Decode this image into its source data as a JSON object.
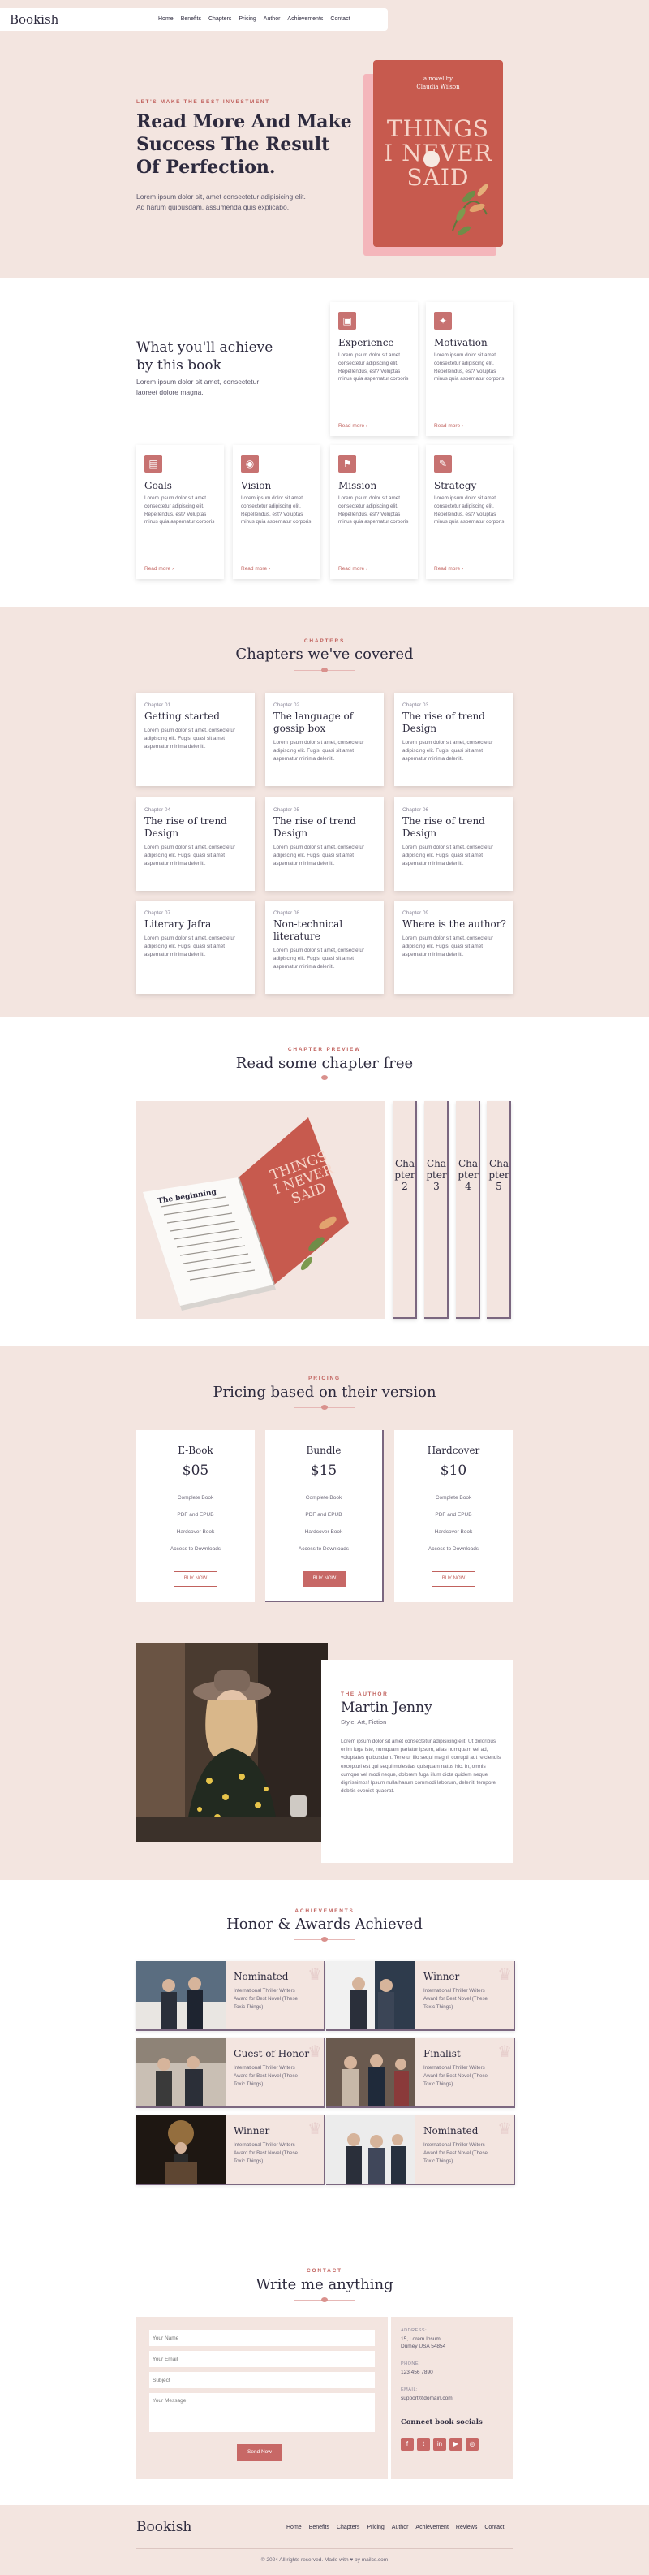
{
  "header": {
    "logo": "Bookish",
    "nav": [
      "Home",
      "Benefits",
      "Chapters",
      "Pricing",
      "Author",
      "Achievements",
      "Contact"
    ]
  },
  "hero": {
    "eyebrow": "Let's make the best investment",
    "title_lines": [
      "Read More And Make",
      "Success The Result",
      "Of Perfection."
    ],
    "text_lines": [
      "Lorem ipsum dolor sit, amet consectetur adipisicing elit.",
      "Ad harum quibusdam, assumenda quis explicabo."
    ],
    "book": {
      "small_lines": [
        "a novel by",
        "Claudia Wilson"
      ],
      "title_lines": [
        "THINGS",
        "I NEVER",
        "SAID"
      ]
    }
  },
  "achieve": {
    "title_lines": [
      "What you'll achieve",
      "by this book"
    ],
    "text_lines": [
      "Lorem ipsum dolor sit amet, consectetur",
      "laoreet dolore magna."
    ],
    "cards": [
      {
        "icon": "experience-icon",
        "glyph": "▣",
        "title": "Experience",
        "text": "Lorem ipsum dolor sit amet consectetur adipiscing elit. Repellendus, est? Voluptas minus quia aspernatur corporis",
        "link": "Read more ›"
      },
      {
        "icon": "motivation-icon",
        "glyph": "✦",
        "title": "Motivation",
        "text": "Lorem ipsum dolor sit amet consectetur adipiscing elit. Repellendus, est? Voluptas minus quia aspernatur corporis",
        "link": "Read more ›"
      },
      {
        "icon": "goals-icon",
        "glyph": "▤",
        "title": "Goals",
        "text": "Lorem ipsum dolor sit amet consectetur adipiscing elit. Repellendus, est? Voluptas minus quia aspernatur corporis",
        "link": "Read more ›"
      },
      {
        "icon": "vision-icon",
        "glyph": "◉",
        "title": "Vision",
        "text": "Lorem ipsum dolor sit amet consectetur adipiscing elit. Repellendus, est? Voluptas minus quia aspernatur corporis",
        "link": "Read more ›"
      },
      {
        "icon": "mission-icon",
        "glyph": "⚑",
        "title": "Mission",
        "text": "Lorem ipsum dolor sit amet consectetur adipiscing elit. Repellendus, est? Voluptas minus quia aspernatur corporis",
        "link": "Read more ›"
      },
      {
        "icon": "strategy-icon",
        "glyph": "✎",
        "title": "Strategy",
        "text": "Lorem ipsum dolor sit amet consectetur adipiscing elit. Repellendus, est? Voluptas minus quia aspernatur corporis",
        "link": "Read more ›"
      }
    ]
  },
  "chapters": {
    "eyebrow": "CHAPTERS",
    "title": "Chapters we've covered",
    "items": [
      {
        "no": "Chapter 01",
        "title": "Getting started",
        "text": "Lorem ipsum dolor sit amet, consectetur adipiscing elit. Fugis, quasi sit amet aspernatur minima deleniti."
      },
      {
        "no": "Chapter 02",
        "title": "The language of gossip box",
        "text": "Lorem ipsum dolor sit amet, consectetur adipiscing elit. Fugis, quasi sit amet aspernatur minima deleniti."
      },
      {
        "no": "Chapter 03",
        "title": "The rise of trend Design",
        "text": "Lorem ipsum dolor sit amet, consectetur adipiscing elit. Fugis, quasi sit amet aspernatur minima deleniti."
      },
      {
        "no": "Chapter 04",
        "title": "The rise of trend Design",
        "text": "Lorem ipsum dolor sit amet, consectetur adipiscing elit. Fugis, quasi sit amet aspernatur minima deleniti."
      },
      {
        "no": "Chapter 05",
        "title": "The rise of trend Design",
        "text": "Lorem ipsum dolor sit amet, consectetur adipiscing elit. Fugis, quasi sit amet aspernatur minima deleniti."
      },
      {
        "no": "Chapter 06",
        "title": "The rise of trend Design",
        "text": "Lorem ipsum dolor sit amet, consectetur adipiscing elit. Fugis, quasi sit amet aspernatur minima deleniti."
      },
      {
        "no": "Chapter 07",
        "title": "Literary Jafra",
        "text": "Lorem ipsum dolor sit amet, consectetur adipiscing elit. Fugis, quasi sit amet aspernatur minima deleniti."
      },
      {
        "no": "Chapter 08",
        "title": "Non-technical literature",
        "text": "Lorem ipsum dolor sit amet, consectetur adipiscing elit. Fugis, quasi sit amet aspernatur minima deleniti."
      },
      {
        "no": "Chapter 09",
        "title": "Where is the author?",
        "text": "Lorem ipsum dolor sit amet, consectetur adipiscing elit. Fugis, quasi sit amet aspernatur minima deleniti."
      }
    ]
  },
  "preview": {
    "eyebrow": "CHAPTER PREVIEW",
    "title": "Read some chapter free",
    "page_heading": "The beginning",
    "book_title_lines": [
      "THINGS",
      "I NEVER",
      "SAID"
    ],
    "tabs": [
      "Chapter 2",
      "Chapter 3",
      "Chapter 4",
      "Chapter 5"
    ]
  },
  "pricing": {
    "eyebrow": "PRICING",
    "title": "Pricing based on their version",
    "plans": [
      {
        "name": "E-Book",
        "price": "$05",
        "features": [
          "Complete Book",
          "PDF and EPUB",
          "Hardcover Book",
          "Access to Downloads"
        ],
        "button": "BUY NOW"
      },
      {
        "name": "Bundle",
        "price": "$15",
        "features": [
          "Complete Book",
          "PDF and EPUB",
          "Hardcover Book",
          "Access to Downloads"
        ],
        "button": "BUY NOW"
      },
      {
        "name": "Hardcover",
        "price": "$10",
        "features": [
          "Complete Book",
          "PDF and EPUB",
          "Hardcover Book",
          "Access to Downloads"
        ],
        "button": "BUY NOW"
      }
    ]
  },
  "author": {
    "eyebrow": "THE AUTHOR",
    "name": "Martin Jenny",
    "role": "Style: Art, Fiction",
    "bio": "Lorem ipsum dolor sit amet consectetur adipisicing elit. Ut doloribus enim fuga iste, numquam pariatur ipsum, alias numquam vel ad, voluptates quibusdam. Tenetur illo sequi magni, corrupti aut reiciendis excepturi est qui sequi molestias quisquam natus hic. In, omnis cumque vel modi neque, dolorem fuga illum dicta quidem neque dignissimos! Ipsum nulla harum commodi laborum, deleniti tempore debitis eveniet quaerat."
  },
  "awards": {
    "eyebrow": "ACHIEVEMENTS",
    "title": "Honor & Awards Achieved",
    "items": [
      {
        "title": "Nominated",
        "text": "International Thriller Writers Award for Best Novel (These Toxic Things)"
      },
      {
        "title": "Winner",
        "text": "International Thriller Writers Award for Best Novel (These Toxic Things)"
      },
      {
        "title": "Guest of Honor",
        "text": "International Thriller Writers Award for Best Novel (These Toxic Things)"
      },
      {
        "title": "Finalist",
        "text": "International Thriller Writers Award for Best Novel (These Toxic Things)"
      },
      {
        "title": "Winner",
        "text": "International Thriller Writers Award for Best Novel (These Toxic Things)"
      },
      {
        "title": "Nominated",
        "text": "International Thriller Writers Award for Best Novel (These Toxic Things)"
      }
    ]
  },
  "contact": {
    "eyebrow": "CONTACT",
    "title": "Write me anything",
    "placeholders": {
      "name": "Your Name",
      "email": "Your Email",
      "subject": "Subject",
      "message": "Your Message"
    },
    "send": "Send Now",
    "address_label": "ADDRESS:",
    "address_lines": [
      "15, Lorem Ipsum,",
      "Dumey USA 54854"
    ],
    "phone_label": "PHONE:",
    "phone": "123 456 7890",
    "email_label": "EMAIL:",
    "email": "support@domain.com",
    "social_title": "Connect book socials",
    "socials": [
      "facebook-icon",
      "twitter-icon",
      "linkedin-icon",
      "youtube-icon",
      "instagram-icon"
    ],
    "social_glyphs": [
      "f",
      "t",
      "in",
      "▶",
      "◎"
    ]
  },
  "footer": {
    "logo": "Bookish",
    "nav": [
      "Home",
      "Benefits",
      "Chapters",
      "Pricing",
      "Author",
      "Achievement",
      "Reviews",
      "Contact"
    ],
    "copyright": "© 2024 All rights reserved. Made with ♥ by mailcs.com"
  },
  "colors": {
    "accent": "#c1625e",
    "dark": "#2d2a3e",
    "blush": "#f3e5e0",
    "button": "#c76866"
  }
}
